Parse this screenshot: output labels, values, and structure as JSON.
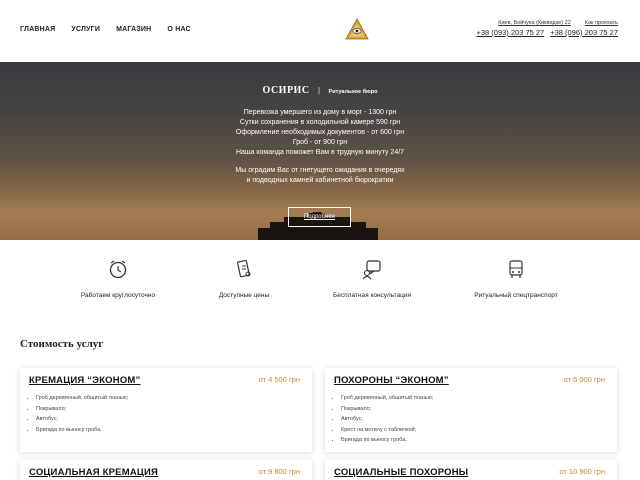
{
  "nav": {
    "items": [
      "ГЛАВНАЯ",
      "УСЛУГИ",
      "МАГАЗИН",
      "О НАС"
    ]
  },
  "logo": {
    "icon": "eye-pyramid-logo"
  },
  "contacts": {
    "address": "Киев, Бойчука (Киквидзе) 22",
    "route": "Как проехать",
    "phone1": "+38 (093) 203 75 27",
    "phone2": "+38 (096) 203 75 27"
  },
  "hero": {
    "brand": "ОСИРИС",
    "separator": "|",
    "subtitle": "Ритуальное бюро",
    "lines": [
      "Перевозка умершего из дому в морг - 1300 грн",
      "Сутки сохранения в холодильной камере 590 грн",
      "Оформление необходимых документов - от 600 грн",
      "Гроб - от 900 грн",
      "Наша команда поможет Вам в трудную минуту 24/7"
    ],
    "lines2": [
      "Мы оградим Вас от гнетущего ожидания в очередях",
      "и подводных камней кабинетной бюрократии"
    ],
    "button": "Подробнее"
  },
  "features": [
    {
      "label": "Работаем круглосуточно",
      "icon": "clock-icon"
    },
    {
      "label": "Доступные цены",
      "icon": "price-tag-icon"
    },
    {
      "label": "Бесплатная консультация",
      "icon": "consultation-icon"
    },
    {
      "label": "Ритуальный спецтранспорт",
      "icon": "bus-icon"
    }
  ],
  "prices": {
    "title": "Стоимость услуг",
    "cards": [
      {
        "title": "КРЕМАЦИЯ “ЭКОНОМ”",
        "price": "от 4 500 грн",
        "items": [
          "Гроб деревянный, обшитый тканью;",
          "Покрывало;",
          "Автобус;",
          "Бригада по выносу гроба."
        ]
      },
      {
        "title": "ПОХОРОНЫ “ЭКОНОМ”",
        "price": "от 5 000 грн",
        "items": [
          "Гроб деревянный, обшитый тканью;",
          "Покрывало;",
          "Автобус;",
          "Крест на могилу с табличкой;",
          "Бригада по выносу гроба."
        ]
      },
      {
        "title": "СОЦИАЛЬНАЯ КРЕМАЦИЯ",
        "price": "от 9 800 грн",
        "items": []
      },
      {
        "title": "СОЦИАЛЬНЫЕ ПОХОРОНЫ",
        "price": "от 10 900 грн",
        "items": []
      }
    ]
  },
  "colors": {
    "accent": "#c4892f",
    "text": "#222222"
  }
}
